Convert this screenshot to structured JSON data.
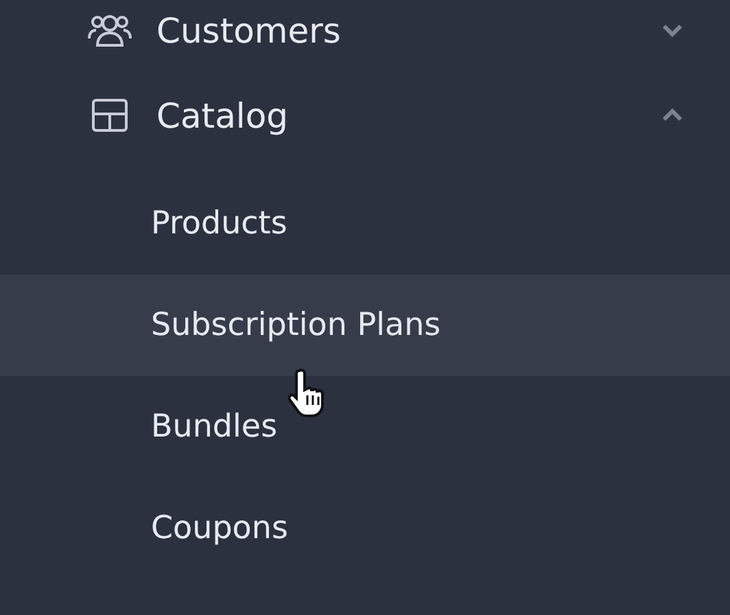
{
  "sidebar": {
    "items": [
      {
        "label": "Customers",
        "expanded": false
      },
      {
        "label": "Catalog",
        "expanded": true,
        "children": [
          {
            "label": "Products",
            "selected": false
          },
          {
            "label": "Subscription Plans",
            "selected": true
          },
          {
            "label": "Bundles",
            "selected": false
          },
          {
            "label": "Coupons",
            "selected": false
          }
        ]
      }
    ]
  }
}
